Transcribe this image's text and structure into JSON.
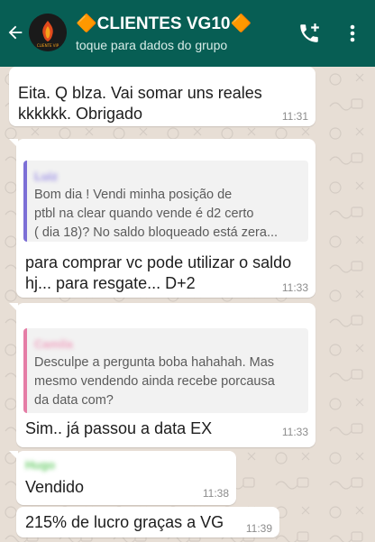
{
  "header": {
    "title": "🔶CLIENTES VG10🔶",
    "subtitle": "toque para dados do grupo",
    "accent": "#075e54"
  },
  "icons": {
    "back": "back-arrow-icon",
    "avatar": "group-avatar",
    "call": "add-call-icon",
    "menu": "more-vert-icon"
  },
  "messages": [
    {
      "text_line1": "Eita. Q blza. Vai somar uns reales",
      "text_line2": "kkkkkk. Obrigado",
      "time": "11:31"
    },
    {
      "quote_name": "Luiz",
      "quote_line1": "Bom dia ! Vendi minha posição de",
      "quote_line2": "ptbl na clear quando vende é d2 certo",
      "quote_line3": "( dia 18)? No saldo bloqueado está zera...",
      "text_line1": "para comprar vc pode utilizar o saldo",
      "text_line2": "hj... para resgate... D+2",
      "time": "11:33"
    },
    {
      "quote_name": "Camila",
      "quote_line1": "Desculpe a pergunta boba hahahah.  Mas",
      "quote_line2": "mesmo vendendo ainda recebe porcausa",
      "quote_line3": "da data com?",
      "text_line1": "Sim.. já passou a data EX",
      "time": "11:33"
    },
    {
      "sender": "Hugo",
      "text_line1": "Vendido",
      "time": "11:38"
    },
    {
      "text_line1": "215%  de lucro graças a VG",
      "time": "11:39"
    }
  ]
}
